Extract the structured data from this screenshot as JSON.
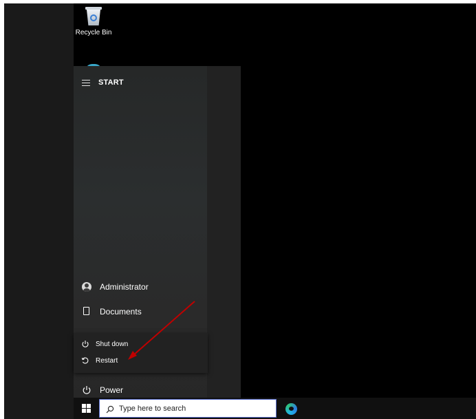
{
  "desktop": {
    "icons": [
      {
        "label": "Recycle Bin",
        "icon": "recycle-bin-icon"
      }
    ]
  },
  "start_menu": {
    "title": "START",
    "items": {
      "user": {
        "label": "Administrator",
        "icon": "user-avatar-icon"
      },
      "documents": {
        "label": "Documents",
        "icon": "document-icon"
      },
      "power": {
        "label": "Power",
        "icon": "power-icon"
      }
    },
    "power_submenu": {
      "shutdown": {
        "label": "Shut down",
        "icon": "power-icon"
      },
      "restart": {
        "label": "Restart",
        "icon": "restart-icon"
      }
    }
  },
  "taskbar": {
    "search": {
      "placeholder": "Type here to search",
      "value": ""
    },
    "pinned": [
      {
        "icon": "edge-browser-icon"
      }
    ]
  },
  "colors": {
    "desktop_background": "#000000",
    "start_menu_background": "#2a2c2d",
    "taskbar_background": "#101010",
    "annotation_arrow": "#c00000",
    "search_border": "#5a6fd0"
  }
}
